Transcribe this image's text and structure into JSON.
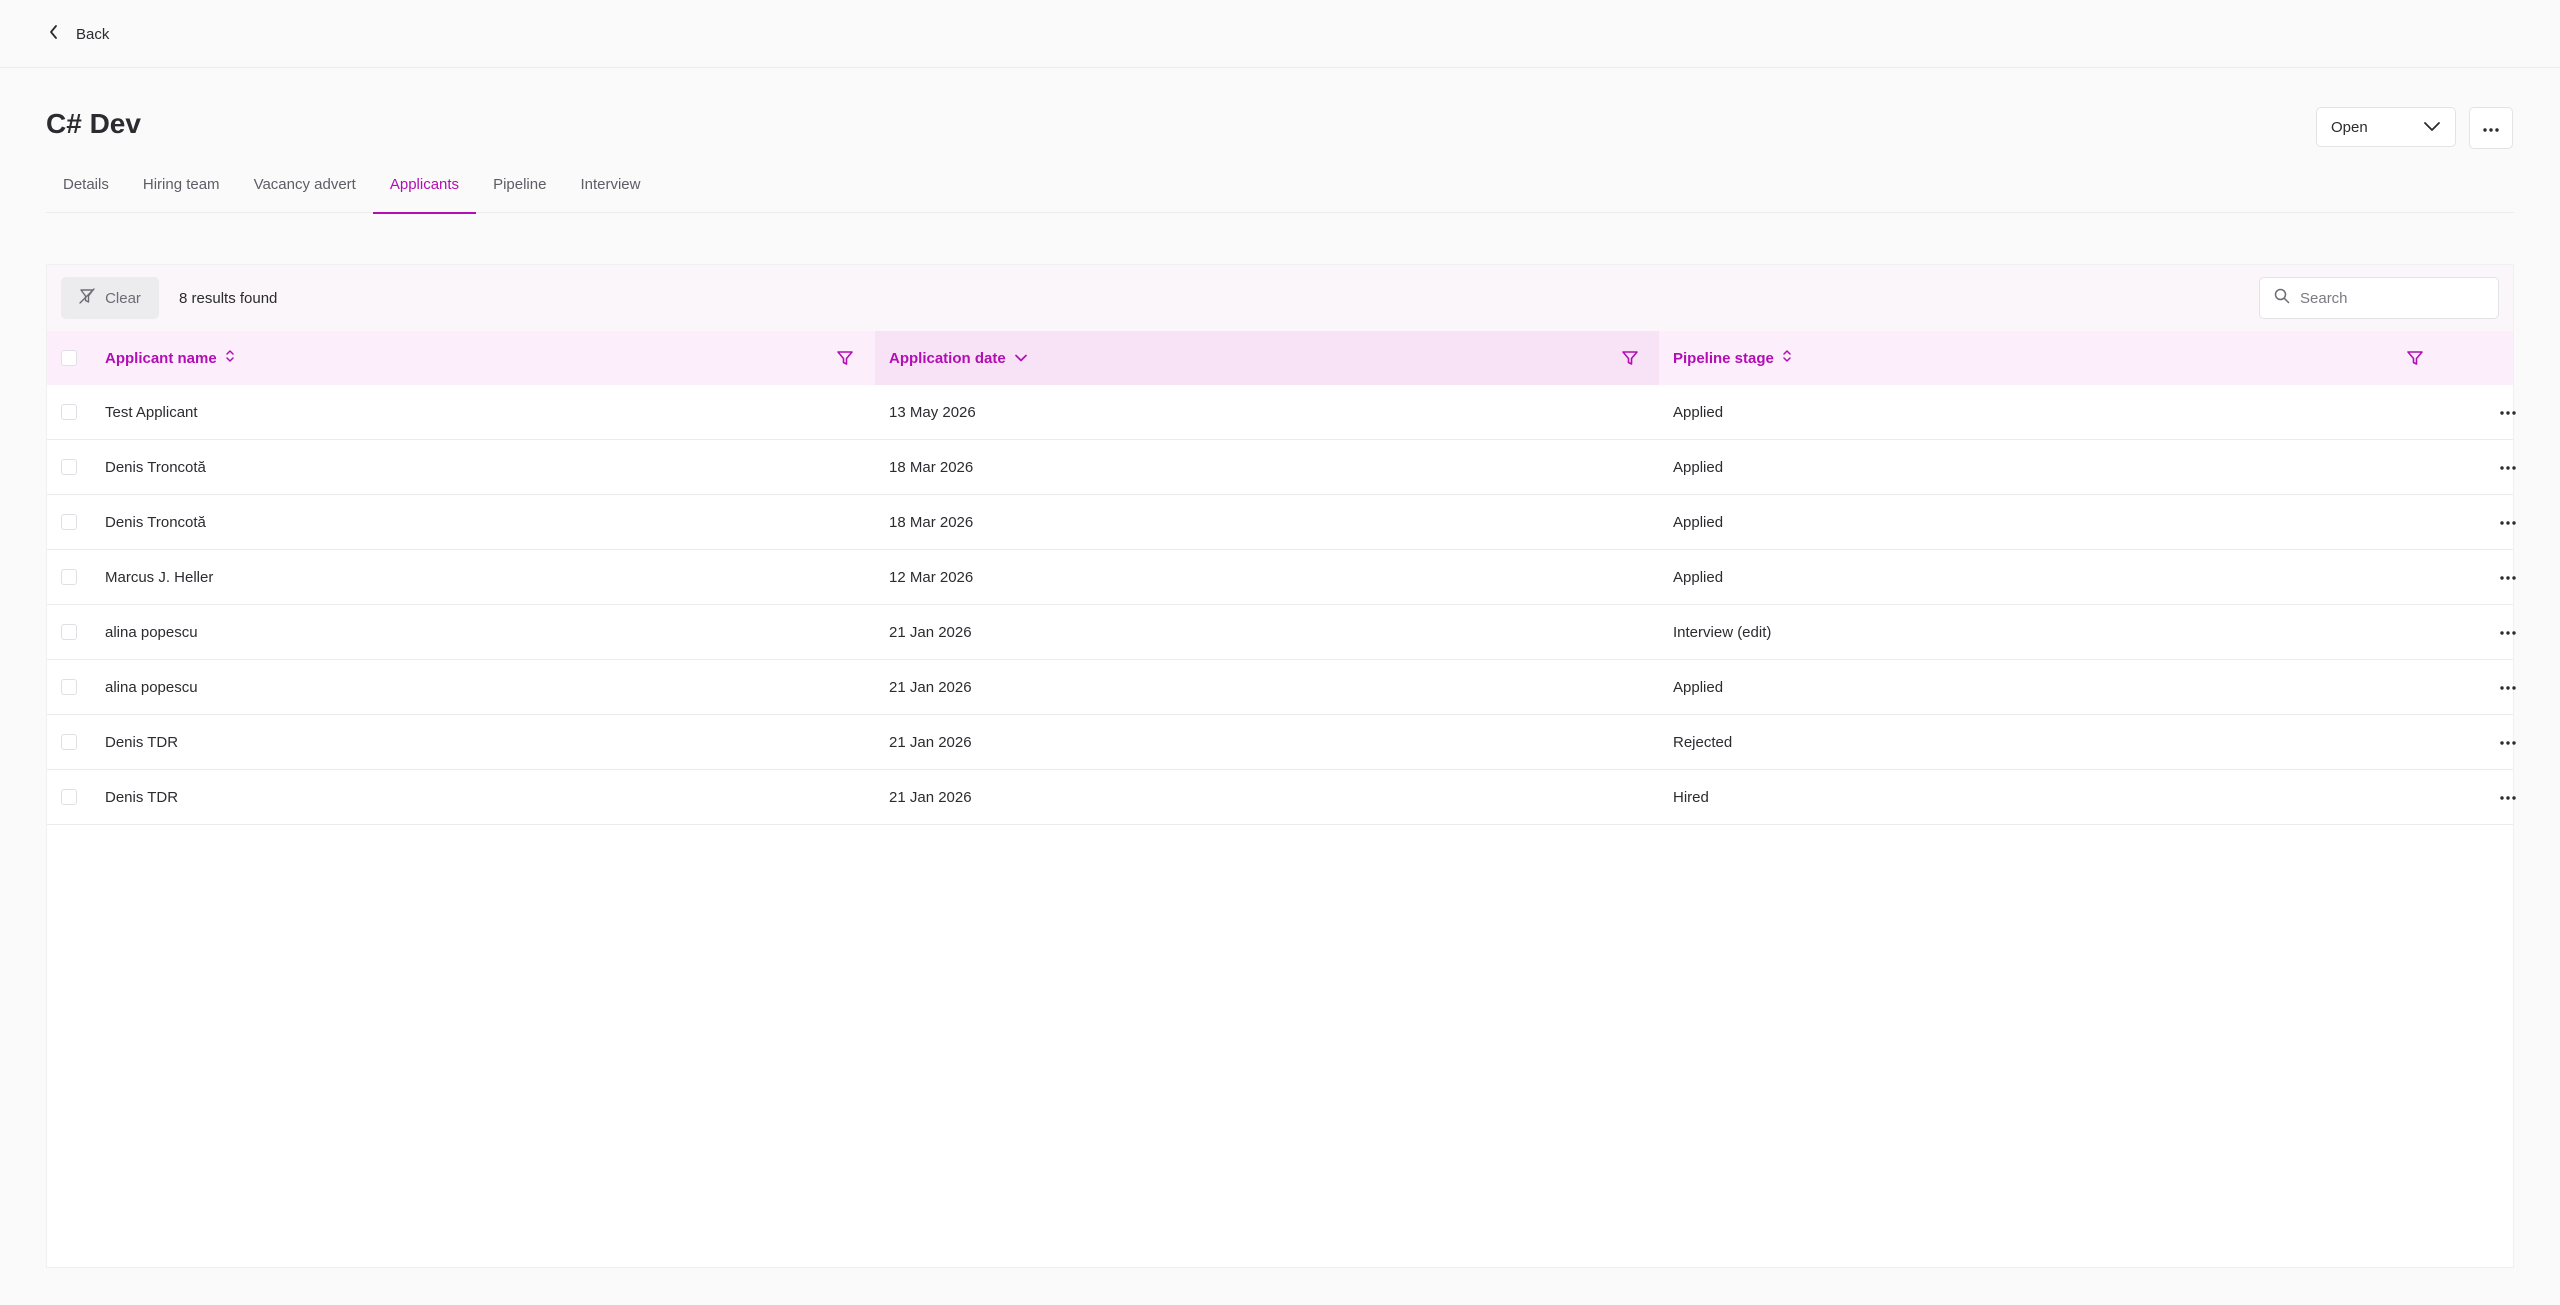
{
  "nav": {
    "back_label": "Back"
  },
  "header": {
    "title": "C# Dev",
    "status_value": "Open"
  },
  "tabs": [
    {
      "label": "Details",
      "active": false
    },
    {
      "label": "Hiring team",
      "active": false
    },
    {
      "label": "Vacancy advert",
      "active": false
    },
    {
      "label": "Applicants",
      "active": true
    },
    {
      "label": "Pipeline",
      "active": false
    },
    {
      "label": "Interview",
      "active": false
    }
  ],
  "toolbar": {
    "clear_label": "Clear",
    "results_text": "8 results found",
    "search_placeholder": "Search"
  },
  "table": {
    "columns": [
      {
        "label": "Applicant name",
        "sort": "unsorted"
      },
      {
        "label": "Application date",
        "sort": "descending"
      },
      {
        "label": "Pipeline stage",
        "sort": "unsorted"
      }
    ],
    "rows": [
      {
        "name": "Test Applicant",
        "date": "13 May 2026",
        "stage": "Applied"
      },
      {
        "name": "Denis Troncotă",
        "date": "18 Mar 2026",
        "stage": "Applied"
      },
      {
        "name": "Denis Troncotă",
        "date": "18 Mar 2026",
        "stage": "Applied"
      },
      {
        "name": "Marcus J. Heller",
        "date": "12 Mar 2026",
        "stage": "Applied"
      },
      {
        "name": "alina popescu",
        "date": "21 Jan 2026",
        "stage": "Interview (edit)"
      },
      {
        "name": "alina popescu",
        "date": "21 Jan 2026",
        "stage": "Applied"
      },
      {
        "name": "Denis TDR",
        "date": "21 Jan 2026",
        "stage": "Rejected"
      },
      {
        "name": "Denis TDR",
        "date": "21 Jan 2026",
        "stage": "Hired"
      }
    ]
  },
  "colors": {
    "accent": "#b10fb4",
    "header_bg": "#fdeefc",
    "sorted_col_bg": "#f8e2f6"
  },
  "icons": [
    "chevron-left-icon",
    "chevron-down-icon",
    "more-horizontal-icon",
    "filter-clear-icon",
    "search-icon",
    "sort-icon",
    "filter-icon"
  ]
}
